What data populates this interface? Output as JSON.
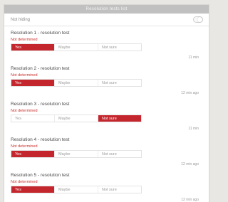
{
  "window": {
    "title": "Resolution tests list"
  },
  "filter": {
    "label": "Not hiding"
  },
  "colors": {
    "accent": "#c4262d",
    "status_text": "#c9332e"
  },
  "items": [
    {
      "title": "Resolution 1 - resolution test",
      "status": "Not determined",
      "options": [
        "Yes",
        "Maybe",
        "Not sure"
      ],
      "selected": 0,
      "date": "11 min"
    },
    {
      "title": "Resolution 2 - resolution test",
      "status": "Not determined",
      "options": [
        "Yes",
        "Maybe",
        "Not sure"
      ],
      "selected": 0,
      "date": "12 min ago"
    },
    {
      "title": "Resolution 3 - resolution test",
      "status": "Not determined",
      "options": [
        "Yes",
        "Maybe",
        "Not sure"
      ],
      "selected": 2,
      "date": "11 min"
    },
    {
      "title": "Resolution 4 - resolution test",
      "status": "Not determined",
      "options": [
        "Yes",
        "Maybe",
        "Not sure"
      ],
      "selected": 0,
      "date": "12 min ago"
    },
    {
      "title": "Resolution 5 - resolution test",
      "status": "Not determined",
      "options": [
        "Yes",
        "Maybe",
        "Not sure"
      ],
      "selected": 0,
      "date": "12 min ago"
    }
  ]
}
